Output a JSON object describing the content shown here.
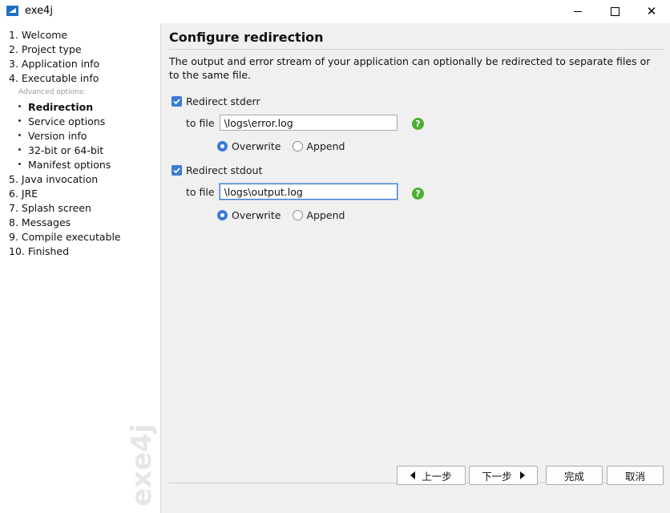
{
  "window": {
    "title": "exe4j",
    "minimize": "minimize",
    "maximize": "maximize",
    "close": "close"
  },
  "sidebar": {
    "steps_top": [
      {
        "label": "1. Welcome"
      },
      {
        "label": "2. Project type"
      },
      {
        "label": "3. Application info"
      },
      {
        "label": "4. Executable info"
      }
    ],
    "advanced_label": "Advanced options:",
    "sub_items": [
      {
        "label": "Redirection",
        "active": true
      },
      {
        "label": "Service options"
      },
      {
        "label": "Version info"
      },
      {
        "label": "32-bit or 64-bit"
      },
      {
        "label": "Manifest options"
      }
    ],
    "steps_bottom": [
      {
        "label": "5. Java invocation"
      },
      {
        "label": "6. JRE"
      },
      {
        "label": "7. Splash screen"
      },
      {
        "label": "8. Messages"
      },
      {
        "label": "9. Compile executable"
      },
      {
        "label": "10. Finished"
      }
    ],
    "watermark": "exe4j"
  },
  "main": {
    "title": "Configure redirection",
    "description": "The output and error stream of your application can optionally be redirected to separate files or to the same file.",
    "stderr": {
      "checkbox_label": "Redirect stderr",
      "checked": true,
      "to_file_label": "to file",
      "file_value": "\\logs\\error.log",
      "overwrite_label": "Overwrite",
      "append_label": "Append",
      "selected": "Overwrite"
    },
    "stdout": {
      "checkbox_label": "Redirect stdout",
      "checked": true,
      "to_file_label": "to file",
      "file_value": "\\logs\\output.log",
      "overwrite_label": "Overwrite",
      "append_label": "Append",
      "selected": "Overwrite"
    },
    "help_glyph": "?"
  },
  "footer": {
    "back_label": "上一步",
    "next_label": "下一步",
    "finish_label": "完成",
    "cancel_label": "取消"
  },
  "colors": {
    "accent": "#3a7bd5",
    "help": "#4caf2f"
  }
}
